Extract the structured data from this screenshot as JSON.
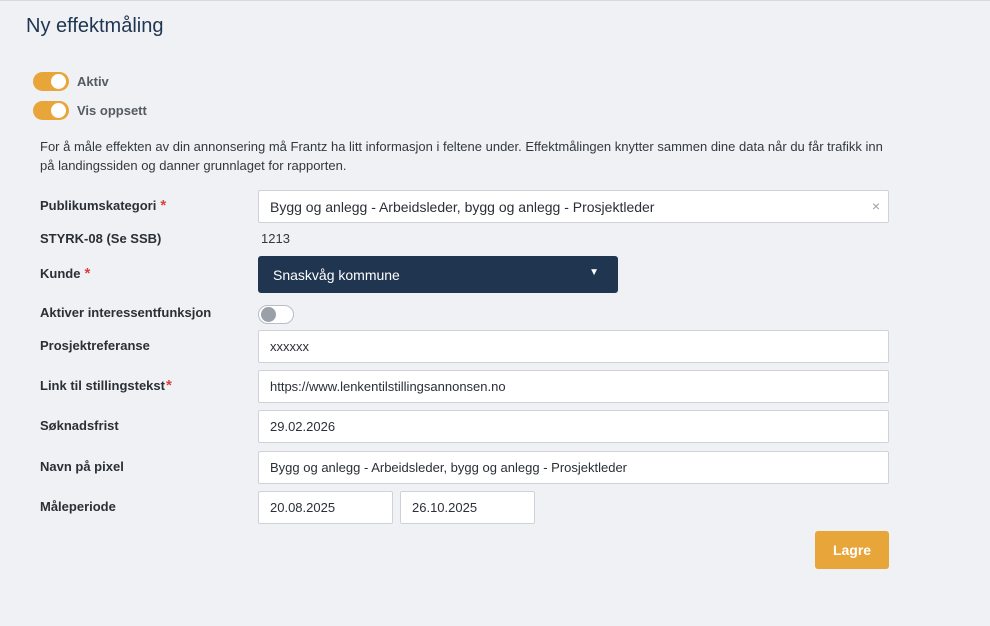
{
  "page": {
    "title": "Ny effektmåling"
  },
  "toggles": {
    "aktiv": {
      "label": "Aktiv",
      "on": true
    },
    "vis_oppsett": {
      "label": "Vis oppsett",
      "on": true
    }
  },
  "intro_text": "For å måle effekten av din annonsering må Frantz ha litt informasjon i feltene under. Effektmålingen knytter sammen dine data når du får trafikk inn på landingssiden og danner grunnlaget for rapporten.",
  "form": {
    "publikumskategori": {
      "label": "Publikumskategori",
      "required_mark": "*",
      "value": "Bygg og anlegg - Arbeidsleder, bygg og anlegg - Prosjektleder",
      "clear_icon": "×"
    },
    "styrk": {
      "label": "STYRK-08 (Se SSB)",
      "value": "1213"
    },
    "kunde": {
      "label": "Kunde",
      "required_mark": "*",
      "value": "Snaskvåg kommune",
      "caret": "▼"
    },
    "interessent": {
      "label": "Aktiver interessentfunksjon",
      "on": false
    },
    "prosjektreferanse": {
      "label": "Prosjektreferanse",
      "value": "xxxxxx"
    },
    "link": {
      "label": "Link til stillingstekst",
      "required_mark": "*",
      "value": "https://www.lenkentilstillingsannonsen.no"
    },
    "soknadsfrist": {
      "label": "Søknadsfrist",
      "value": "29.02.2026"
    },
    "pixel": {
      "label": "Navn på pixel",
      "value": "Bygg og anlegg - Arbeidsleder, bygg og anlegg - Prosjektleder"
    },
    "maleperiode": {
      "label": "Måleperiode",
      "from": "20.08.2025",
      "to": "26.10.2025"
    }
  },
  "actions": {
    "save_label": "Lagre"
  },
  "colors": {
    "accent": "#e8a53a",
    "navy": "#1f3550",
    "required": "#d94040",
    "background": "#eff1f4"
  }
}
